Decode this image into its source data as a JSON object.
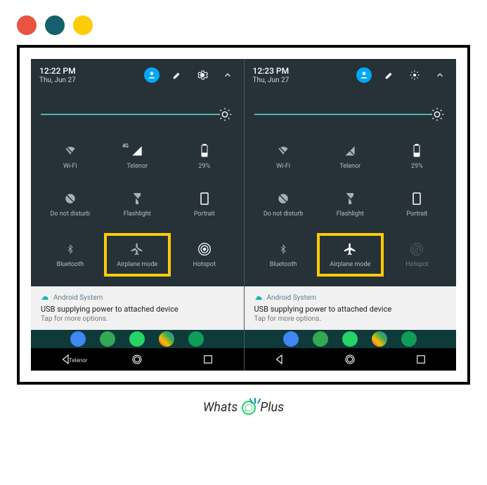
{
  "dots": {
    "colors": [
      "#e85441",
      "#17606e",
      "#fccb0a"
    ]
  },
  "left": {
    "time": "12:22 PM",
    "date": "Thu, Jun 27",
    "tiles": {
      "wifi": "Wi-Fi",
      "carrier": "Telenor",
      "battery": "29%",
      "dnd": "Do not disturb",
      "flashlight": "Flashlight",
      "portrait": "Portrait",
      "bluetooth": "Bluetooth",
      "airplane": "Airplane mode",
      "hotspot": "Hotspot"
    },
    "carrier_badge": "4G",
    "home_label": "Telenor",
    "notif": {
      "app": "Android System",
      "title": "USB supplying power to attached device",
      "sub": "Tap for more options."
    }
  },
  "right": {
    "time": "12:23 PM",
    "date": "Thu, Jun 27",
    "tiles": {
      "wifi": "Wi-Fi",
      "carrier": "Telenor",
      "battery": "29%",
      "dnd": "Do not disturb",
      "flashlight": "Flashlight",
      "portrait": "Portrait",
      "bluetooth": "Bluetooth",
      "airplane": "Airplane mode",
      "hotspot": "Hotspot"
    },
    "notif": {
      "app": "Android System",
      "title": "USB supplying power to attached device",
      "sub": "Tap for more options."
    }
  },
  "footer": {
    "whats": "Whats",
    "plus": "Plus"
  }
}
